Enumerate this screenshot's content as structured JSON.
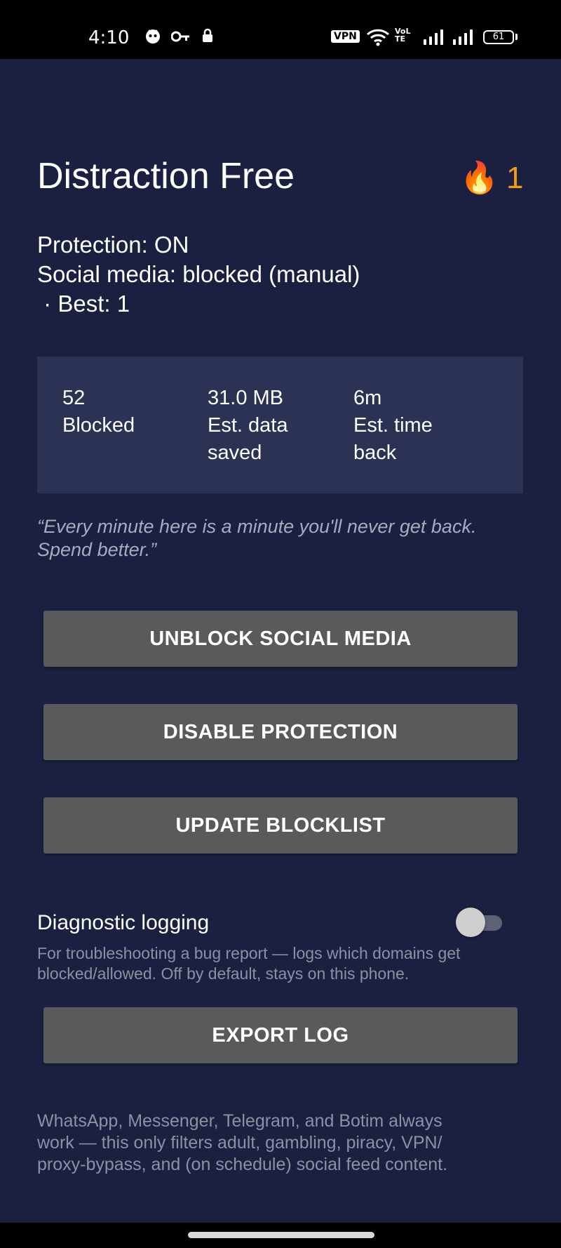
{
  "status_bar": {
    "time": "4:10",
    "icons": [
      "face-icon",
      "key-icon",
      "lock-icon",
      "vpn-icon",
      "wifi-icon",
      "volte-icon",
      "signal-icon",
      "battery-icon"
    ],
    "vpn_label": "VPN",
    "lte_label": "VoLTE",
    "battery_level": "61"
  },
  "header": {
    "title": "Distraction Free",
    "streak_icon": "🔥",
    "streak_count": "1",
    "streak_color": "#f39c12"
  },
  "status": {
    "protection": "Protection: ON",
    "social": "Social media: blocked (manual)",
    "best": " · Best: 1"
  },
  "stats": [
    {
      "value": "52",
      "label_line1": "Blocked",
      "label_line2": ""
    },
    {
      "value": "31.0 MB",
      "label_line1": "Est. data",
      "label_line2": "saved"
    },
    {
      "value": "6m",
      "label_line1": "Est. time",
      "label_line2": "back"
    }
  ],
  "quote": {
    "line1": "“Every minute here is a minute you'll never get back.",
    "line2": "Spend better.”"
  },
  "buttons": {
    "unblock_social": "UNBLOCK SOCIAL MEDIA",
    "disable_protection": "DISABLE PROTECTION",
    "update_blocklist": "UPDATE BLOCKLIST",
    "export_log": "EXPORT LOG"
  },
  "diagnostic": {
    "label": "Diagnostic logging",
    "enabled": false,
    "desc_line1": "For troubleshooting a bug report — logs which domains get",
    "desc_line2": "blocked/allowed. Off by default, stays on this phone."
  },
  "footer": {
    "line1": "WhatsApp, Messenger, Telegram, and Botim always",
    "line2": "work — this only filters adult, gambling, piracy, VPN/",
    "line3": "proxy-bypass, and (on schedule) social feed content."
  },
  "colors": {
    "background": "#1c2040",
    "card": "#2c3254",
    "button": "#5a5a5c",
    "accent": "#f39c12"
  }
}
